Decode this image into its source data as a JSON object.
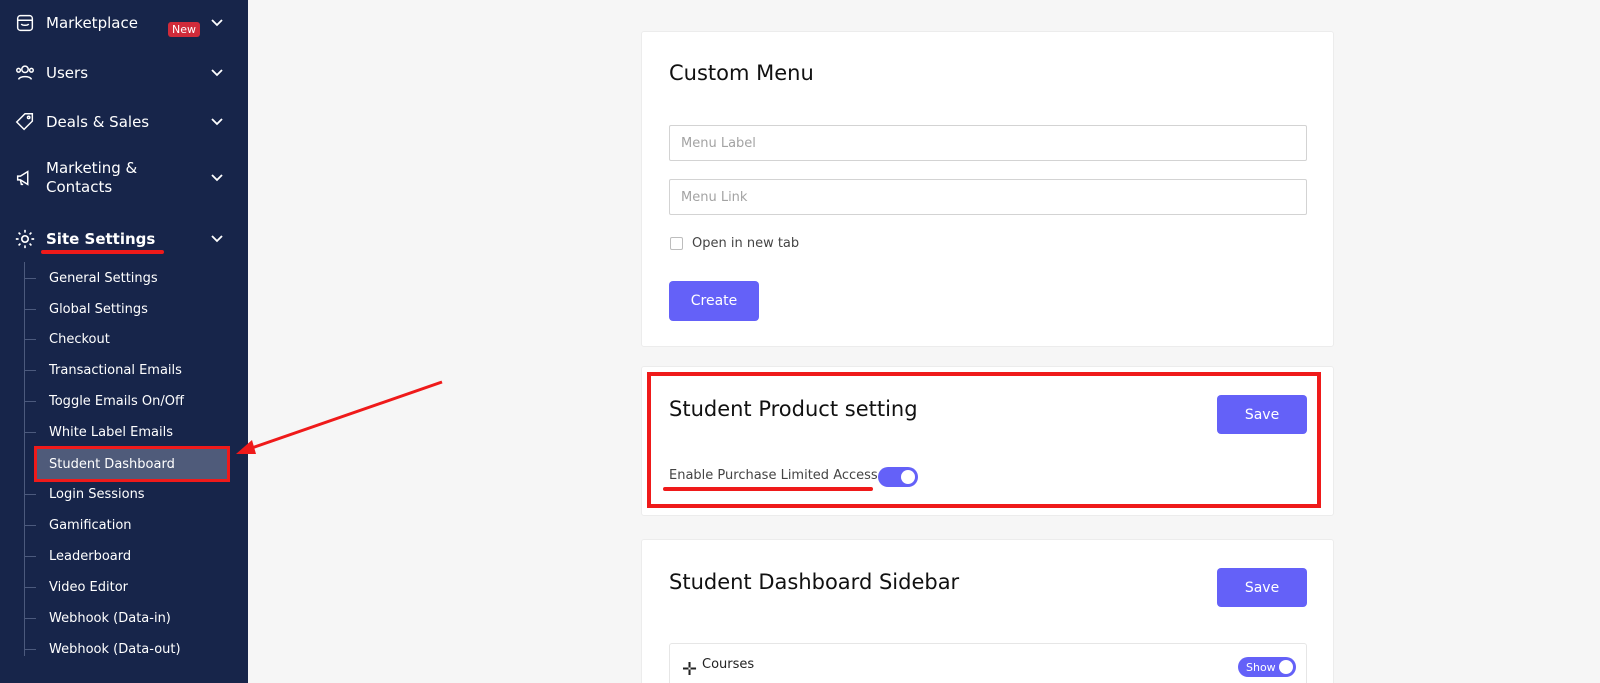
{
  "sidebar": {
    "items": [
      {
        "label": "Marketplace",
        "icon": "store-icon",
        "badge": "New"
      },
      {
        "label": "Users",
        "icon": "users-icon"
      },
      {
        "label": "Deals & Sales",
        "icon": "tag-icon"
      },
      {
        "label": "Marketing &",
        "label2": "Contacts",
        "icon": "megaphone-icon"
      },
      {
        "label": "Site Settings",
        "icon": "gear-icon"
      }
    ],
    "sub_items": [
      "General Settings",
      "Global Settings",
      "Checkout",
      "Transactional Emails",
      "Toggle Emails On/Off",
      "White Label Emails",
      "Student Dashboard",
      "Login Sessions",
      "Gamification",
      "Leaderboard",
      "Video Editor",
      "Webhook (Data-in)",
      "Webhook (Data-out)"
    ],
    "active_sub_item": "Student Dashboard"
  },
  "custom_menu": {
    "title": "Custom Menu",
    "menu_label_placeholder": "Menu Label",
    "menu_link_placeholder": "Menu Link",
    "open_new_tab_label": "Open in new tab",
    "create_label": "Create"
  },
  "student_product": {
    "title": "Student Product setting",
    "save_label": "Save",
    "enable_label": "Enable Purchase Limited Access :",
    "enabled": true
  },
  "dashboard_sidebar": {
    "title": "Student Dashboard Sidebar",
    "save_label": "Save",
    "rows": [
      {
        "label": "Courses",
        "toggle_label": "Show"
      }
    ]
  },
  "colors": {
    "sidebar_bg": "#17254a",
    "accent": "#6461f8",
    "annotation_red": "#ef1a1a",
    "badge_red": "#d02b3a"
  }
}
